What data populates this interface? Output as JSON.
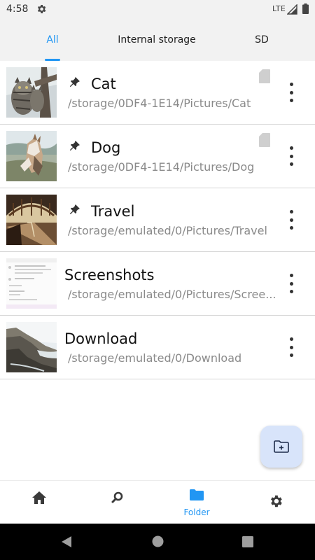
{
  "status_bar": {
    "time": "4:58",
    "network": "LTE"
  },
  "tabs": [
    {
      "label": "All",
      "active": true
    },
    {
      "label": "Internal storage",
      "active": false
    },
    {
      "label": "SD",
      "active": false
    }
  ],
  "folders": [
    {
      "name": "Cat",
      "path": "/storage/0DF4-1E14/Pictures/Cat",
      "pinned": true,
      "sd_card": true,
      "thumbnail": "cat-photo"
    },
    {
      "name": "Dog",
      "path": "/storage/0DF4-1E14/Pictures/Dog",
      "pinned": true,
      "sd_card": true,
      "thumbnail": "dog-photo"
    },
    {
      "name": "Travel",
      "path": "/storage/emulated/0/Pictures/Travel",
      "pinned": true,
      "sd_card": false,
      "thumbnail": "train-station-photo"
    },
    {
      "name": "Screenshots",
      "path": "/storage/emulated/0/Pictures/Scree...",
      "pinned": false,
      "sd_card": false,
      "thumbnail": "screenshot-preview"
    },
    {
      "name": "Download",
      "path": "/storage/emulated/0/Download",
      "pinned": false,
      "sd_card": false,
      "thumbnail": "cliff-coast-photo"
    }
  ],
  "fab": {
    "icon": "create-folder-icon"
  },
  "bottom_nav": [
    {
      "icon": "home-icon",
      "label": ""
    },
    {
      "icon": "search-icon",
      "label": ""
    },
    {
      "icon": "folder-icon",
      "label": "Folder",
      "active": true
    },
    {
      "icon": "settings-gear-icon",
      "label": ""
    }
  ],
  "colors": {
    "accent": "#2196f3",
    "tab_bar_bg": "#f2f2f2",
    "fab_bg": "#d8e4fa",
    "path_text": "#8a8a8a"
  }
}
